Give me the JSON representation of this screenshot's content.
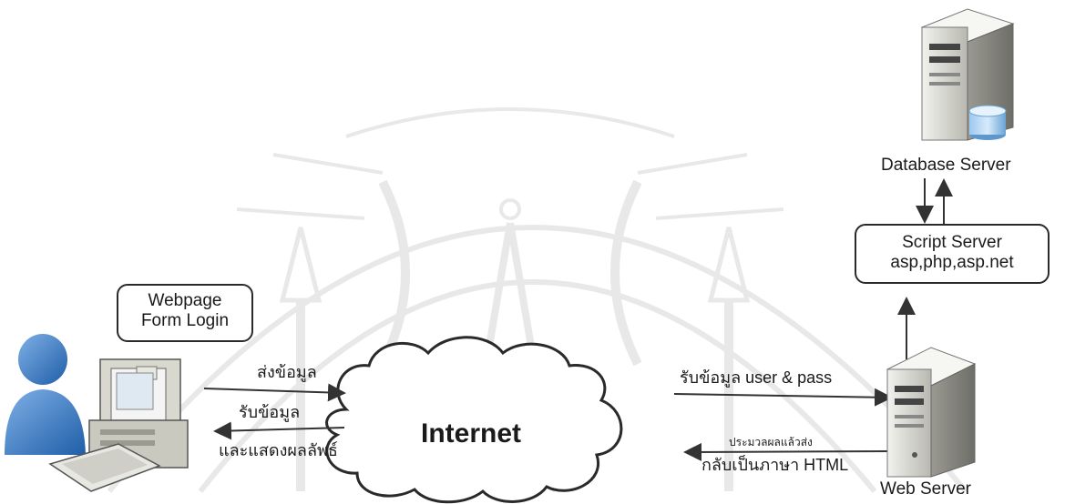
{
  "client": {
    "form_box": {
      "line1": "Webpage",
      "line2": "Form Login"
    },
    "send_label": "ส่งข้อมูล",
    "receive_label_1": "รับข้อมูล",
    "receive_label_2": "และแสดงผลลัพธ์"
  },
  "network": {
    "cloud_label": "Internet"
  },
  "web_server": {
    "label": "Web Server",
    "receive_label": "รับข้อมูล user & pass",
    "return_label_1": "ประมวลผลแล้วส่ง",
    "return_label_2": "กลับเป็นภาษา HTML"
  },
  "script_server": {
    "line1": "Script Server",
    "line2": "asp,php,asp.net"
  },
  "database_server": {
    "label": "Database Server"
  }
}
